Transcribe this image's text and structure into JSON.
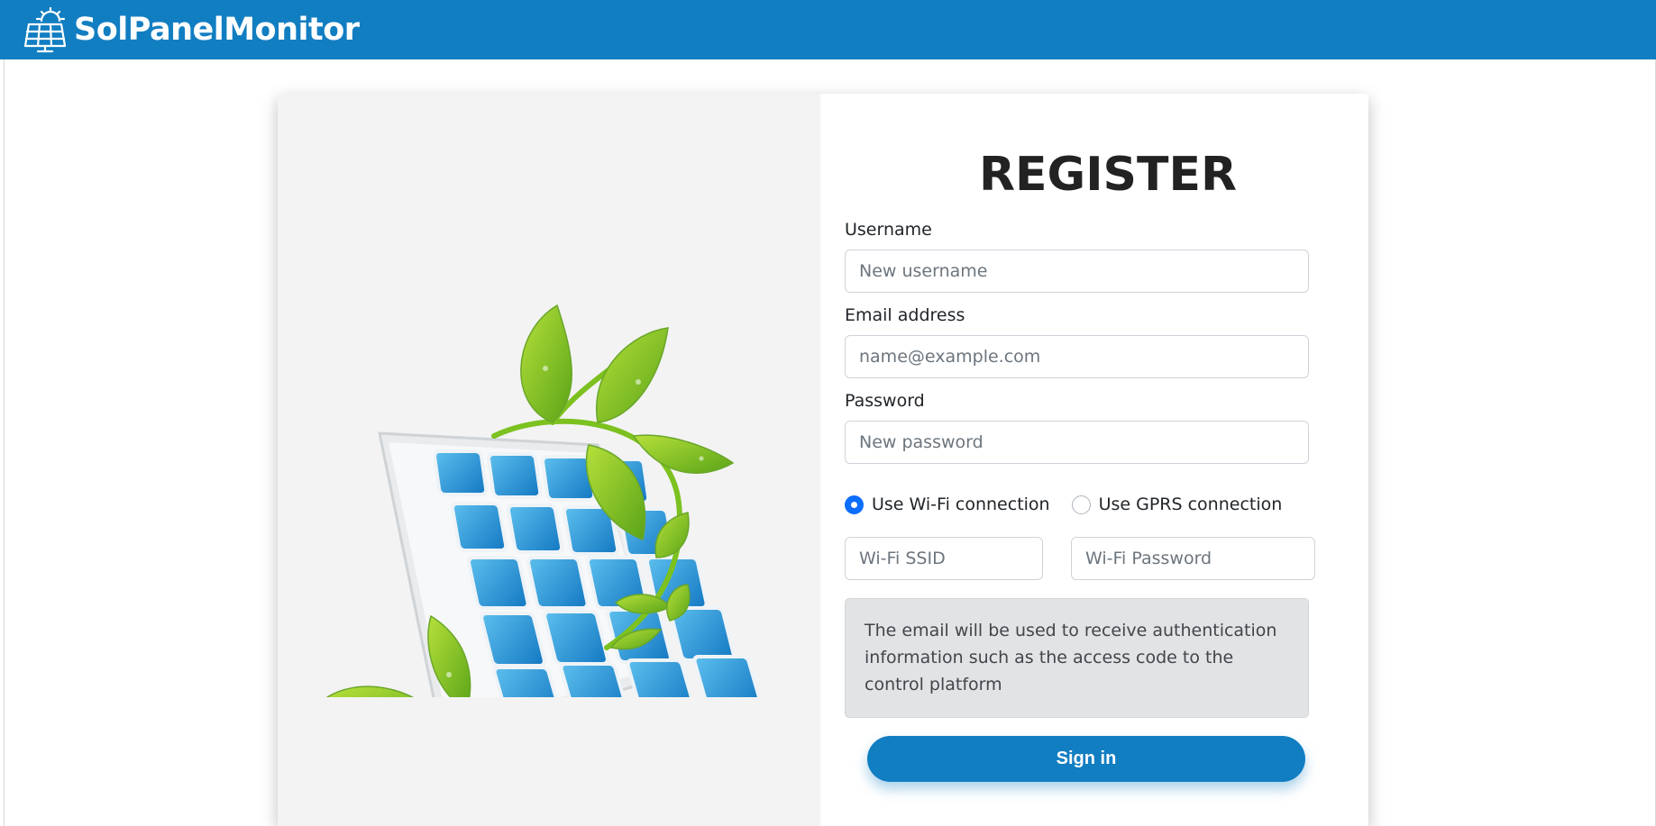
{
  "header": {
    "brand_name": "SolPanelMonitor",
    "brand_icon": "solar-panel-sun-icon",
    "brand_color": "#127ec2"
  },
  "register": {
    "title": "REGISTER",
    "username_label": "Username",
    "username_placeholder": "New username",
    "email_label": "Email address",
    "email_placeholder": "name@example.com",
    "password_label": "Password",
    "password_placeholder": "New password",
    "connection_options": [
      {
        "label": "Use Wi-Fi connection",
        "selected": true
      },
      {
        "label": "Use GPRS connection",
        "selected": false
      }
    ],
    "wifi_ssid_placeholder": "Wi-Fi SSID",
    "wifi_password_placeholder": "Wi-Fi Password",
    "info_text": "The email will be used to receive authentication information such as the access code to the control platform",
    "submit_label": "Sign in"
  },
  "illustration": {
    "icon": "solar-panel-with-leaves-illustration"
  }
}
